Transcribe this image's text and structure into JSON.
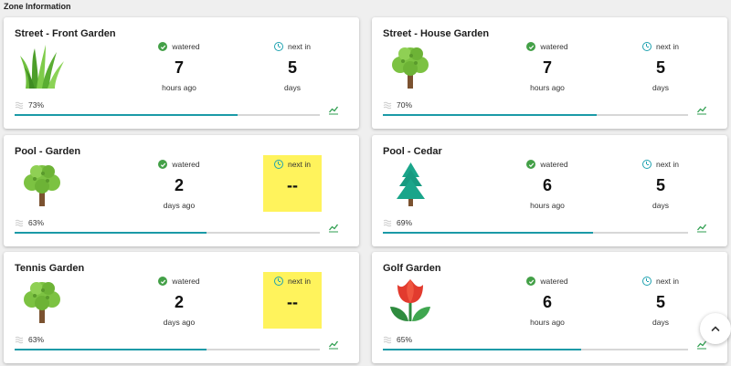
{
  "section_title": "Zone Information",
  "zones": [
    {
      "name": "Street - Front Garden",
      "plant_icon": "grass-icon",
      "watered_label": "watered",
      "watered_value": "7",
      "watered_unit": "hours ago",
      "next_label": "next in",
      "next_value": "5",
      "next_unit": "days",
      "next_highlight": false,
      "humidity_text": "73%",
      "humidity_fraction": 0.73
    },
    {
      "name": "Street - House Garden",
      "plant_icon": "tree-icon",
      "watered_label": "watered",
      "watered_value": "7",
      "watered_unit": "hours ago",
      "next_label": "next in",
      "next_value": "5",
      "next_unit": "days",
      "next_highlight": false,
      "humidity_text": "70%",
      "humidity_fraction": 0.7
    },
    {
      "name": "Pool - Garden",
      "plant_icon": "tree-icon",
      "watered_label": "watered",
      "watered_value": "2",
      "watered_unit": "days ago",
      "next_label": "next in",
      "next_value": "--",
      "next_unit": "",
      "next_highlight": true,
      "humidity_text": "63%",
      "humidity_fraction": 0.63
    },
    {
      "name": "Pool - Cedar",
      "plant_icon": "evergreen-tree-icon",
      "watered_label": "watered",
      "watered_value": "6",
      "watered_unit": "hours ago",
      "next_label": "next in",
      "next_value": "5",
      "next_unit": "days",
      "next_highlight": false,
      "humidity_text": "69%",
      "humidity_fraction": 0.69
    },
    {
      "name": "Tennis Garden",
      "plant_icon": "tree-icon",
      "watered_label": "watered",
      "watered_value": "2",
      "watered_unit": "days ago",
      "next_label": "next in",
      "next_value": "--",
      "next_unit": "",
      "next_highlight": true,
      "humidity_text": "63%",
      "humidity_fraction": 0.63
    },
    {
      "name": "Golf Garden",
      "plant_icon": "tulip-icon",
      "watered_label": "watered",
      "watered_value": "6",
      "watered_unit": "hours ago",
      "next_label": "next in",
      "next_value": "5",
      "next_unit": "days",
      "next_highlight": false,
      "humidity_text": "65%",
      "humidity_fraction": 0.65
    }
  ],
  "colors": {
    "progress": "#1b9aa7",
    "check": "#43a047",
    "clock": "#1fa2b0",
    "highlight": "#fff35c",
    "chart": "#2e9e4f"
  },
  "scroll_button_icon": "chevron-up-icon"
}
